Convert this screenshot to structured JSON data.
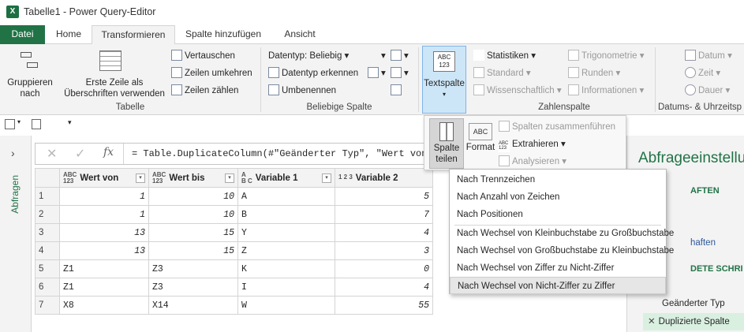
{
  "window": {
    "title": "Tabelle1 - Power Query-Editor",
    "app_icon": "X"
  },
  "tabs": [
    "Datei",
    "Home",
    "Transformieren",
    "Spalte hinzufügen",
    "Ansicht"
  ],
  "ribbon": {
    "tabelle": {
      "label": "Tabelle",
      "gruppieren": "Gruppieren\nnach",
      "erste_zeile": "Erste Zeile als\nÜberschriften verwenden",
      "vertauschen": "Vertauschen",
      "zeilen_umkehren": "Zeilen umkehren",
      "zeilen_zaehlen": "Zeilen zählen"
    },
    "beliebige": {
      "label": "Beliebige Spalte",
      "datentyp": "Datentyp: Beliebig",
      "datentyp_erkennen": "Datentyp erkennen",
      "umbenennen": "Umbenennen"
    },
    "textspalte": "Textspalte",
    "zahlenspalte": {
      "label": "Zahlenspalte",
      "statistiken": "Statistiken",
      "standard": "Standard",
      "wissenschaftlich": "Wissenschaftlich",
      "trigonometrie": "Trigonometrie",
      "runden": "Runden",
      "informationen": "Informationen"
    },
    "datum": {
      "label": "Datums- & Uhrzeitsp",
      "datum": "Datum",
      "zeit": "Zeit",
      "dauer": "Dauer"
    }
  },
  "subpopup": {
    "spalte_teilen": "Spalte\nteilen",
    "format": "Format",
    "zusammenfuehren": "Spalten zusammenführen",
    "extrahieren": "Extrahieren",
    "analysieren": "Analysieren",
    "abc": "ABC\n123"
  },
  "left_pane": {
    "label": "Abfragen"
  },
  "formula": "= Table.DuplicateColumn(#\"Geänderter Typ\", \"Wert von\", \"",
  "table": {
    "columns": [
      {
        "type": "ABC\n123",
        "name": "Wert von"
      },
      {
        "type": "ABC\n123",
        "name": "Wert bis"
      },
      {
        "type": "A\nB C",
        "name": "Variable 1"
      },
      {
        "type": "1 2 3",
        "name": "Variable 2"
      }
    ],
    "rows": [
      {
        "n": "1",
        "a": "1",
        "b": "10",
        "c": "A",
        "d": "5"
      },
      {
        "n": "2",
        "a": "1",
        "b": "10",
        "c": "B",
        "d": "7"
      },
      {
        "n": "3",
        "a": "13",
        "b": "15",
        "c": "Y",
        "d": "4"
      },
      {
        "n": "4",
        "a": "13",
        "b": "15",
        "c": "Z",
        "d": "3"
      },
      {
        "n": "5",
        "a": "Z1",
        "b": "Z3",
        "c": "K",
        "d": "0"
      },
      {
        "n": "6",
        "a": "Z1",
        "b": "Z3",
        "c": "I",
        "d": "4"
      },
      {
        "n": "7",
        "a": "X8",
        "b": "X14",
        "c": "W",
        "d": "55"
      }
    ]
  },
  "menu": [
    "Nach Trennzeichen",
    "Nach Anzahl von Zeichen",
    "Nach Positionen",
    "Nach Wechsel von Kleinbuchstabe zu Großbuchstabe",
    "Nach Wechsel von Großbuchstabe zu Kleinbuchstabe",
    "Nach Wechsel von Ziffer zu Nicht-Ziffer",
    "Nach Wechsel von Nicht-Ziffer zu Ziffer"
  ],
  "right_pane": {
    "title": "Abfrageeinstellu",
    "section1": "AFTEN",
    "link": "haften",
    "section2": "DETE SCHRI",
    "steps": [
      "Geänderter Typ",
      "Duplizierte Spalte"
    ],
    "delete_glyph": "✕"
  }
}
